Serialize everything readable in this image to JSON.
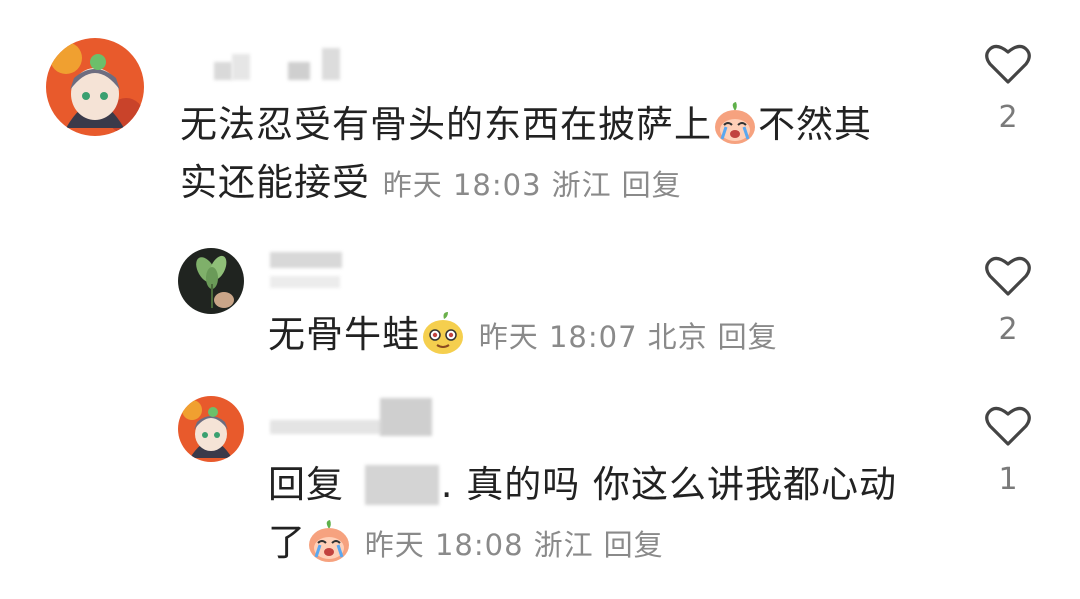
{
  "comments": [
    {
      "text_line1": "无法忍受有骨头的东西在披萨上",
      "text_after_emoji": "不然其",
      "text_line2": "实还能接受",
      "time": "昨天 18:03",
      "location": "浙江",
      "reply_label": "回复",
      "like_count": "2",
      "emoji": "crying-peach-emoji"
    },
    {
      "text": "无骨牛蛙",
      "time": "昨天 18:07",
      "location": "北京",
      "reply_label": "回复",
      "like_count": "2",
      "emoji": "pear-face-emoji"
    },
    {
      "reply_prefix": "回复",
      "text_line1": ". 真的吗 你这么讲我都心动",
      "text_line2": "了",
      "time": "昨天 18:08",
      "location": "浙江",
      "reply_label": "回复",
      "like_count": "1",
      "emoji": "crying-peach-emoji"
    }
  ],
  "colors": {
    "text": "#222222",
    "meta": "#8a8a8a",
    "heart_outline": "#444444"
  }
}
